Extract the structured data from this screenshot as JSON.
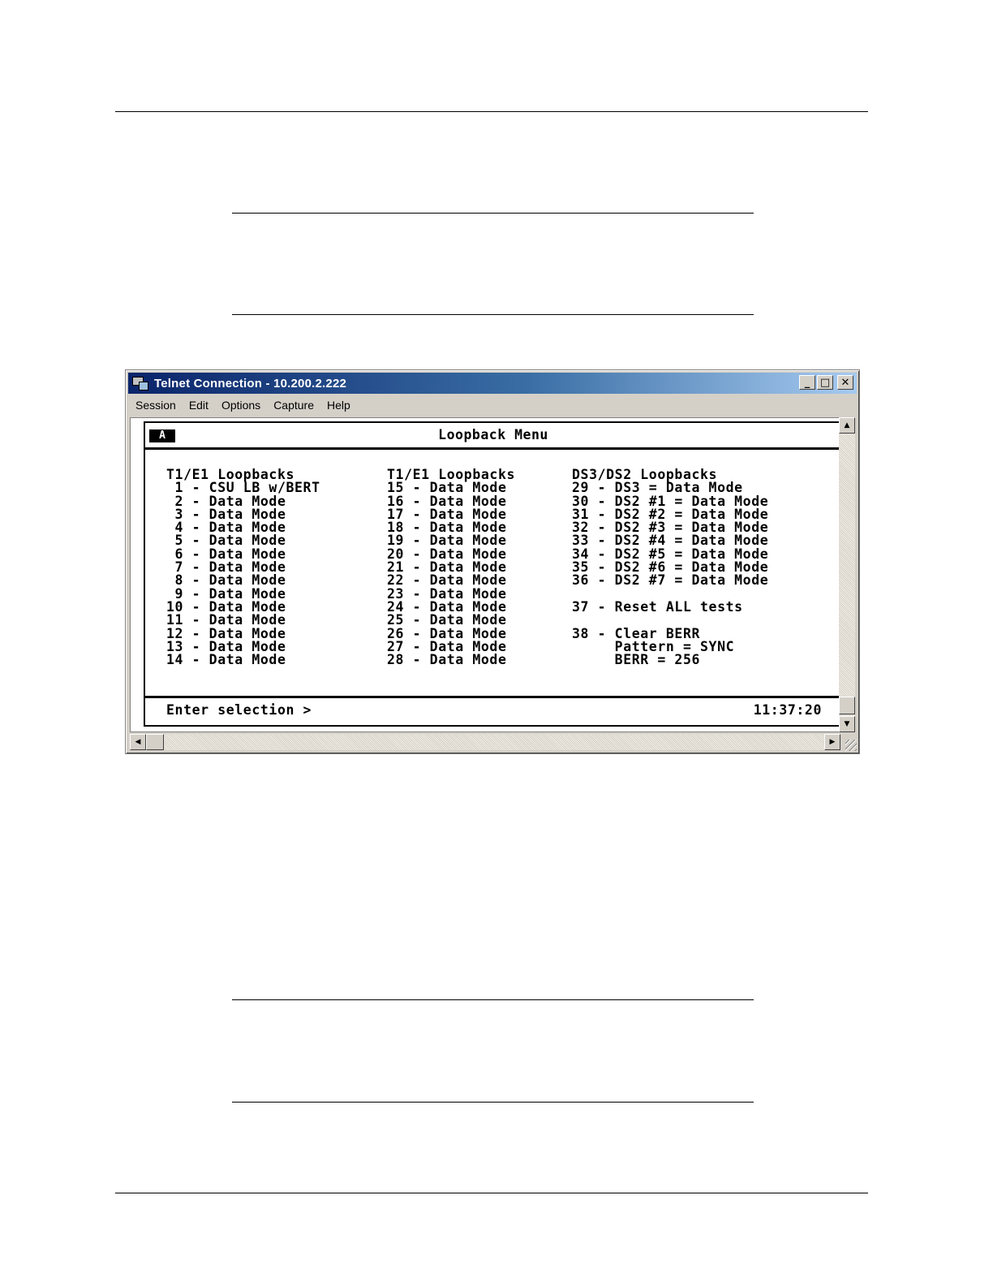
{
  "window": {
    "title": "Telnet Connection - 10.200.2.222",
    "buttons": {
      "minimize": "_",
      "maximize": "□",
      "close": "✕"
    }
  },
  "menubar": [
    "Session",
    "Edit",
    "Options",
    "Capture",
    "Help"
  ],
  "terminal": {
    "session_badge": "A",
    "title": "Loopback Menu",
    "columns": [
      {
        "lines": [
          "T1/E1 Loopbacks",
          " 1 - CSU LB w/BERT",
          " 2 - Data Mode",
          " 3 - Data Mode",
          " 4 - Data Mode",
          " 5 - Data Mode",
          " 6 - Data Mode",
          " 7 - Data Mode",
          " 8 - Data Mode",
          " 9 - Data Mode",
          "10 - Data Mode",
          "11 - Data Mode",
          "12 - Data Mode",
          "13 - Data Mode",
          "14 - Data Mode"
        ]
      },
      {
        "lines": [
          "T1/E1 Loopbacks",
          "15 - Data Mode",
          "16 - Data Mode",
          "17 - Data Mode",
          "18 - Data Mode",
          "19 - Data Mode",
          "20 - Data Mode",
          "21 - Data Mode",
          "22 - Data Mode",
          "23 - Data Mode",
          "24 - Data Mode",
          "25 - Data Mode",
          "26 - Data Mode",
          "27 - Data Mode",
          "28 - Data Mode"
        ]
      },
      {
        "lines": [
          "DS3/DS2 Loopbacks",
          "29 - DS3 = Data Mode",
          "30 - DS2 #1 = Data Mode",
          "31 - DS2 #2 = Data Mode",
          "32 - DS2 #3 = Data Mode",
          "33 - DS2 #4 = Data Mode",
          "34 - DS2 #5 = Data Mode",
          "35 - DS2 #6 = Data Mode",
          "36 - DS2 #7 = Data Mode",
          "",
          "37 - Reset ALL tests",
          "",
          "38 - Clear BERR",
          "     Pattern = SYNC",
          "     BERR = 256"
        ]
      }
    ],
    "prompt": "Enter selection >",
    "clock": "11:37:20"
  },
  "scrollbars": {
    "up": "▲",
    "down": "▼",
    "left": "◀",
    "right": "▶"
  }
}
